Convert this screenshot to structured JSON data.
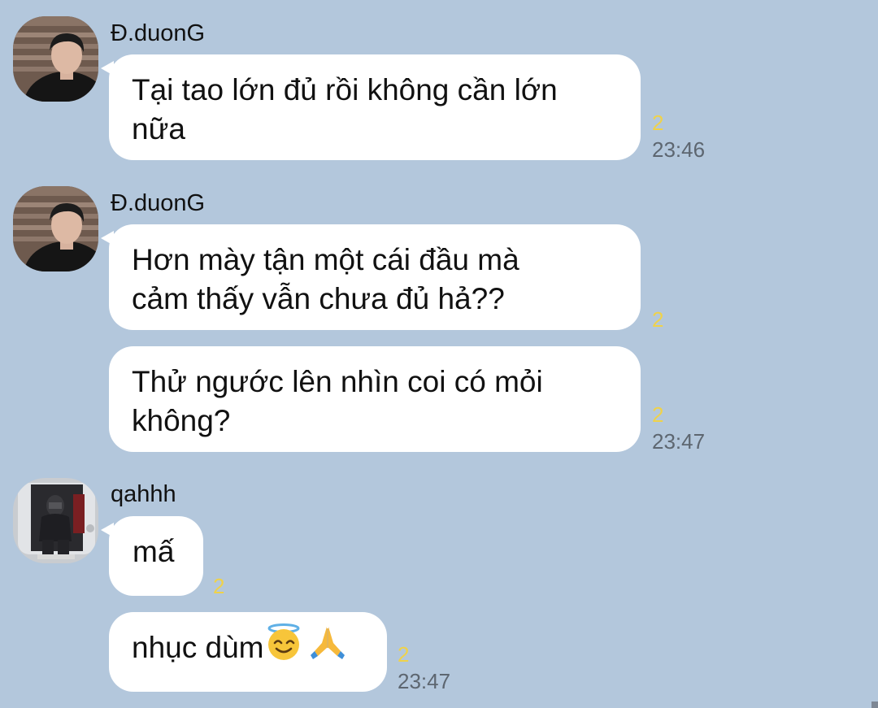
{
  "colors": {
    "background": "#B3C7DC",
    "bubble": "#FFFFFF",
    "read_count": "#EFD24A",
    "timestamp": "#5D6670",
    "text": "#111111"
  },
  "icons": {
    "smiling_face_with_halo": "smiling-face-with-halo-emoji",
    "folded_hands": "folded-hands-emoji"
  },
  "messages": [
    {
      "sender": "Đ.duonG",
      "lines": [
        "Tại tao lớn đủ rồi không cần lớn",
        "nữa"
      ],
      "read_count": "2",
      "time": "23:46"
    },
    {
      "sender": "Đ.duonG",
      "lines": [
        "Hơn mày tận một cái đầu mà",
        "cảm thấy vẫn chưa đủ hả??"
      ],
      "read_count": "2"
    },
    {
      "lines": [
        "Thử ngước lên nhìn coi có mỏi",
        "không?"
      ],
      "read_count": "2",
      "time": "23:47"
    },
    {
      "sender": "qahhh",
      "lines": [
        "mấ"
      ],
      "read_count": "2"
    },
    {
      "lines": [
        "nhục dùm"
      ],
      "read_count": "2",
      "time": "23:47"
    }
  ]
}
